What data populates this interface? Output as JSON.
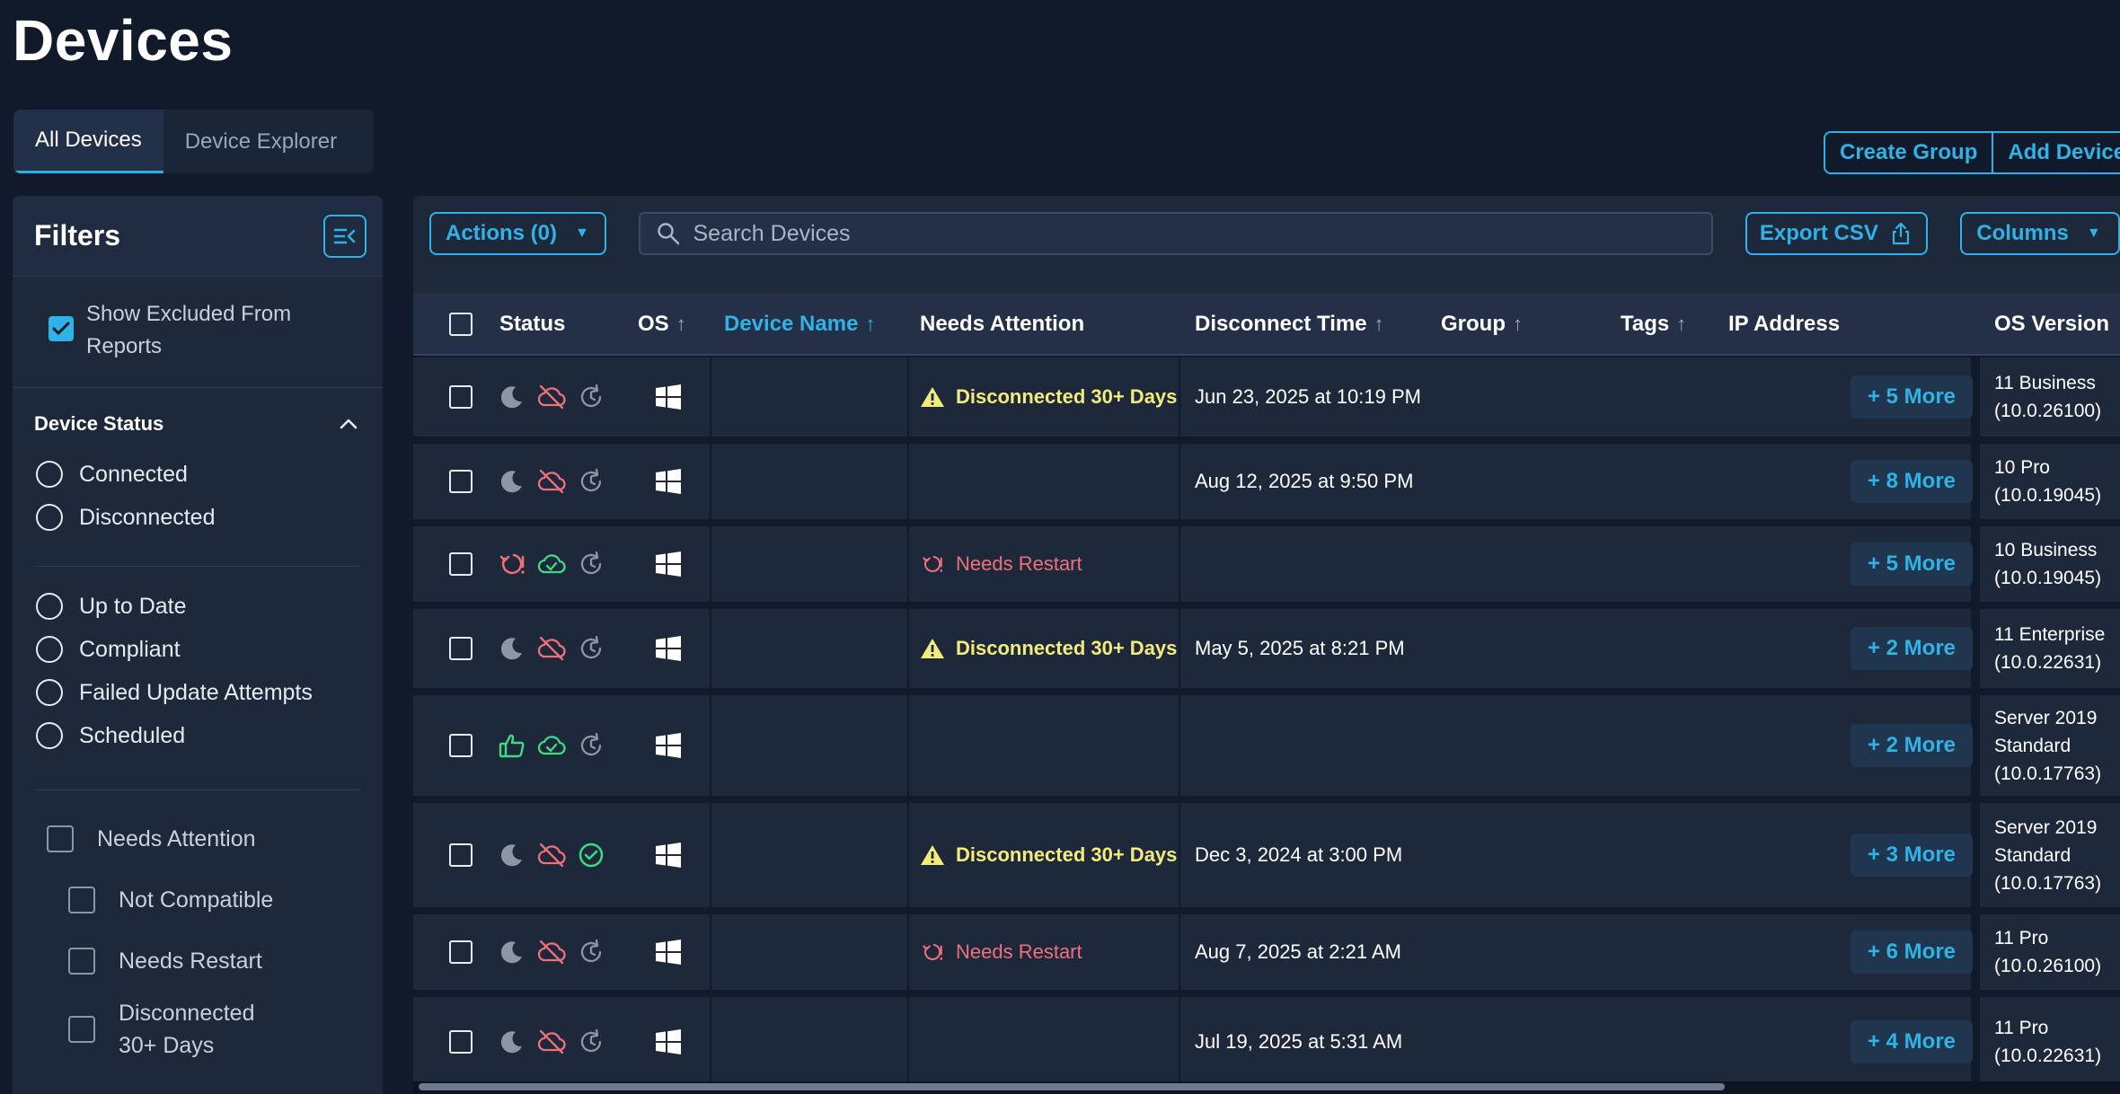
{
  "page": {
    "title": "Devices"
  },
  "tabs": [
    {
      "label": "All Devices"
    },
    {
      "label": "Device Explorer"
    }
  ],
  "top_buttons": {
    "create_group": "Create Group",
    "add_device": "Add Device"
  },
  "filters": {
    "title": "Filters",
    "show_excluded": {
      "label": "Show Excluded From Reports",
      "checked": true
    },
    "device_status": {
      "title": "Device Status",
      "group1": [
        "Connected",
        "Disconnected"
      ],
      "group2": [
        "Up to Date",
        "Compliant",
        "Failed Update Attempts",
        "Scheduled"
      ]
    },
    "needs_attention": {
      "label": "Needs Attention",
      "children": [
        "Not Compatible",
        "Needs Restart",
        "Disconnected 30+ Days"
      ]
    }
  },
  "toolbar": {
    "actions_label": "Actions (0)",
    "search_placeholder": "Search Devices",
    "export_label": "Export CSV",
    "columns_label": "Columns"
  },
  "table": {
    "headers": {
      "status": "Status",
      "os": "OS",
      "device_name": "Device Name",
      "needs_attention": "Needs Attention",
      "disconnect_time": "Disconnect Time",
      "group": "Group",
      "tags": "Tags",
      "ip_address": "IP Address",
      "os_version": "OS Version"
    },
    "sorted_column": "device_name",
    "rows": [
      {
        "state": "sleep",
        "cloud": "disconnected",
        "update": "pending",
        "os": "windows",
        "attention": "Disconnected 30+ Days",
        "attention_type": "warn",
        "disconnect_time": "Jun 23, 2025 at 10:19 PM",
        "more": "+ 5 More",
        "os_version": "11 Business\n(10.0.26100)"
      },
      {
        "state": "sleep",
        "cloud": "disconnected",
        "update": "pending",
        "os": "windows",
        "attention": "",
        "attention_type": "",
        "disconnect_time": "Aug 12, 2025 at 9:50 PM",
        "more": "+ 8 More",
        "os_version": "10 Pro\n(10.0.19045)"
      },
      {
        "state": "restart",
        "cloud": "connected",
        "update": "pending",
        "os": "windows",
        "attention": "Needs Restart",
        "attention_type": "restart",
        "disconnect_time": "",
        "more": "+ 5 More",
        "os_version": "10 Business\n(10.0.19045)"
      },
      {
        "state": "sleep",
        "cloud": "disconnected",
        "update": "pending",
        "os": "windows",
        "attention": "Disconnected 30+ Days",
        "attention_type": "warn",
        "disconnect_time": "May 5, 2025 at 8:21 PM",
        "more": "+ 2 More",
        "os_version": "11 Enterprise\n(10.0.22631)"
      },
      {
        "state": "thumbs-up",
        "cloud": "connected",
        "update": "pending",
        "os": "windows",
        "attention": "",
        "attention_type": "",
        "disconnect_time": "",
        "more": "+ 2 More",
        "os_version": "Server 2019\nStandard\n(10.0.17763)"
      },
      {
        "state": "sleep",
        "cloud": "disconnected",
        "update": "up-to-date",
        "os": "windows",
        "attention": "Disconnected 30+ Days",
        "attention_type": "warn",
        "disconnect_time": "Dec 3, 2024 at 3:00 PM",
        "more": "+ 3 More",
        "os_version": "Server 2019\nStandard\n(10.0.17763)"
      },
      {
        "state": "sleep",
        "cloud": "disconnected",
        "update": "pending",
        "os": "windows",
        "attention": "Needs Restart",
        "attention_type": "restart",
        "disconnect_time": "Aug 7, 2025 at 2:21 AM",
        "more": "+ 6 More",
        "os_version": "11 Pro\n(10.0.26100)"
      },
      {
        "state": "sleep",
        "cloud": "disconnected",
        "update": "pending",
        "os": "windows",
        "attention": "",
        "attention_type": "",
        "disconnect_time": "Jul 19, 2025 at 5:31 AM",
        "more": "+ 4 More",
        "os_version": "11 Pro\n(10.0.22631)"
      }
    ]
  },
  "colors": {
    "accent": "#2fb3e6",
    "warning": "#f4ec7a",
    "danger": "#f0707a",
    "success": "#3ddc84"
  }
}
